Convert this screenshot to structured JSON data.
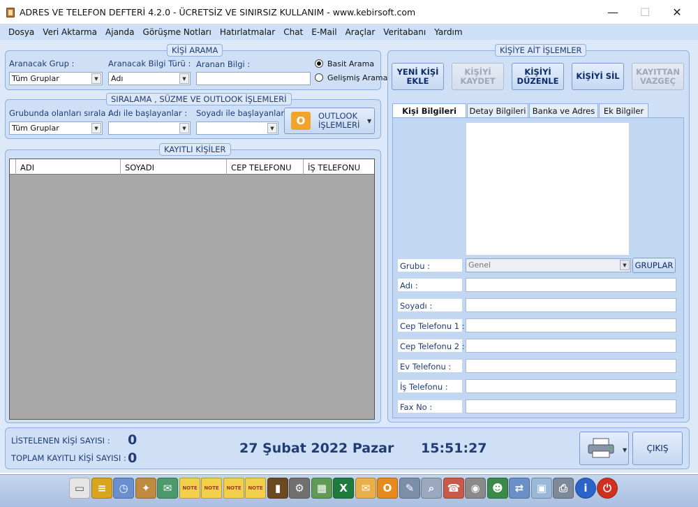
{
  "window": {
    "title": "ADRES VE TELEFON DEFTERİ  4.2.0 - ÜCRETSİZ VE SINIRSIZ KULLANIM -  www.kebirsoft.com",
    "min_glyph": "—",
    "max_glyph": "☐",
    "close_glyph": "✕"
  },
  "menu": [
    "Dosya",
    "Veri Aktarma",
    "Ajanda",
    "Görüşme Notları",
    "Hatırlatmalar",
    "Chat",
    "E-Mail",
    "Araçlar",
    "Veritabanı",
    "Yardım"
  ],
  "search": {
    "legend": "KİŞİ ARAMA",
    "group_label": "Aranacak Grup :",
    "group_value": "Tüm Gruplar",
    "type_label": "Aranacak Bilgi Türü :",
    "type_value": "Adı",
    "query_label": "Aranan Bilgi :",
    "query_value": "",
    "radio_basic": "Basit Arama",
    "radio_advanced": "Gelişmiş Arama",
    "selected_mode": "basic"
  },
  "filter": {
    "legend": "SIRALAMA , SÜZME VE OUTLOOK İŞLEMLERİ",
    "sort_label": "Grubunda olanları sırala :",
    "sort_value": "Tüm Gruplar",
    "name_label": "Adı ile başlayanlar :",
    "name_value": "",
    "surname_label": "Soyadı ile başlayanlar :",
    "surname_value": "",
    "outlook_button_line1": "OUTLOOK",
    "outlook_button_line2": "İŞLEMLERİ"
  },
  "contacts": {
    "legend": "KAYITLI KİŞİLER",
    "columns": [
      "ADI",
      "SOYADI",
      "CEP TELEFONU",
      "İŞ TELEFONU"
    ],
    "rows": []
  },
  "person_actions": {
    "legend": "KİŞİYE AİT İŞLEMLER",
    "buttons": [
      {
        "line1": "YENİ KİŞİ",
        "line2": "EKLE",
        "enabled": true
      },
      {
        "line1": "KİŞİYİ",
        "line2": "KAYDET",
        "enabled": false
      },
      {
        "line1": "KİŞİYİ",
        "line2": "DÜZENLE",
        "enabled": true
      },
      {
        "line1": "KİŞİYİ SİL",
        "line2": "",
        "enabled": true
      },
      {
        "line1": "KAYITTAN",
        "line2": "VAZGEÇ",
        "enabled": false
      }
    ]
  },
  "tabs": [
    "Kişi Bilgileri",
    "Detay Bilgileri",
    "Banka ve Adres",
    "Ek Bilgiler"
  ],
  "active_tab": 0,
  "form": {
    "group_label": "Grubu :",
    "group_value": "Genel",
    "groups_button": "GRUPLAR",
    "fields": [
      {
        "label": "Adı :",
        "value": ""
      },
      {
        "label": "Soyadı :",
        "value": ""
      },
      {
        "label": "Cep Telefonu 1 :",
        "value": ""
      },
      {
        "label": "Cep Telefonu 2 :",
        "value": ""
      },
      {
        "label": "Ev Telefonu :",
        "value": ""
      },
      {
        "label": "İş Telefonu :",
        "value": ""
      },
      {
        "label": "Fax No :",
        "value": ""
      }
    ]
  },
  "status": {
    "listed_label": "LİSTELENEN KİŞİ SAYISI :",
    "listed_count": "0",
    "total_label": "TOPLAM KAYITLI KİŞİ SAYISI :",
    "total_count": "0",
    "date": "27 Şubat 2022 Pazar",
    "time": "15:51:27",
    "exit_button": "ÇIKIŞ"
  },
  "toolbar_icons": [
    {
      "name": "notepad-icon",
      "color": "#e6e6e6",
      "glyph": "▭"
    },
    {
      "name": "notebook-icon",
      "color": "#d9a520",
      "glyph": "≡"
    },
    {
      "name": "calendar-clock-icon",
      "color": "#6a8fd0",
      "glyph": "◷"
    },
    {
      "name": "people-icon",
      "color": "#c08a40",
      "glyph": "✦"
    },
    {
      "name": "globe-mail-icon",
      "color": "#4a9a6a",
      "glyph": "✉"
    },
    {
      "name": "note-icon-1",
      "color": "#f2d04a",
      "glyph": "NOTE"
    },
    {
      "name": "note-icon-2",
      "color": "#f2d04a",
      "glyph": "NOTE"
    },
    {
      "name": "note-icon-3",
      "color": "#f2d04a",
      "glyph": "NOTE"
    },
    {
      "name": "note-icon-4",
      "color": "#f2d04a",
      "glyph": "NOTE"
    },
    {
      "name": "book-icon",
      "color": "#6b4a22",
      "glyph": "▮"
    },
    {
      "name": "gear-icon",
      "color": "#707070",
      "glyph": "⚙"
    },
    {
      "name": "spreadsheet-icon",
      "color": "#5f9b55",
      "glyph": "▦"
    },
    {
      "name": "excel-icon",
      "color": "#1f7a3e",
      "glyph": "X"
    },
    {
      "name": "envelope-icon",
      "color": "#e9b04a",
      "glyph": "✉"
    },
    {
      "name": "outlook-icon",
      "color": "#e58a1e",
      "glyph": "O"
    },
    {
      "name": "tools-icon",
      "color": "#7c8ea8",
      "glyph": "✎"
    },
    {
      "name": "magnifier-icon",
      "color": "#9aa9bd",
      "glyph": "⌕"
    },
    {
      "name": "address-book-icon",
      "color": "#c85a4a",
      "glyph": "☎"
    },
    {
      "name": "hard-disk-icon",
      "color": "#8a8a8a",
      "glyph": "◉"
    },
    {
      "name": "user-icon",
      "color": "#3a8a4a",
      "glyph": "☻"
    },
    {
      "name": "network-icon",
      "color": "#6b8fc8",
      "glyph": "⇄"
    },
    {
      "name": "database-icon",
      "color": "#9ab8d8",
      "glyph": "▣"
    },
    {
      "name": "printer-icon",
      "color": "#7d8898",
      "glyph": "⎙"
    },
    {
      "name": "info-icon",
      "color": "#2a64c8",
      "glyph": "i"
    },
    {
      "name": "power-icon",
      "color": "#d03020",
      "glyph": "⏻"
    }
  ]
}
